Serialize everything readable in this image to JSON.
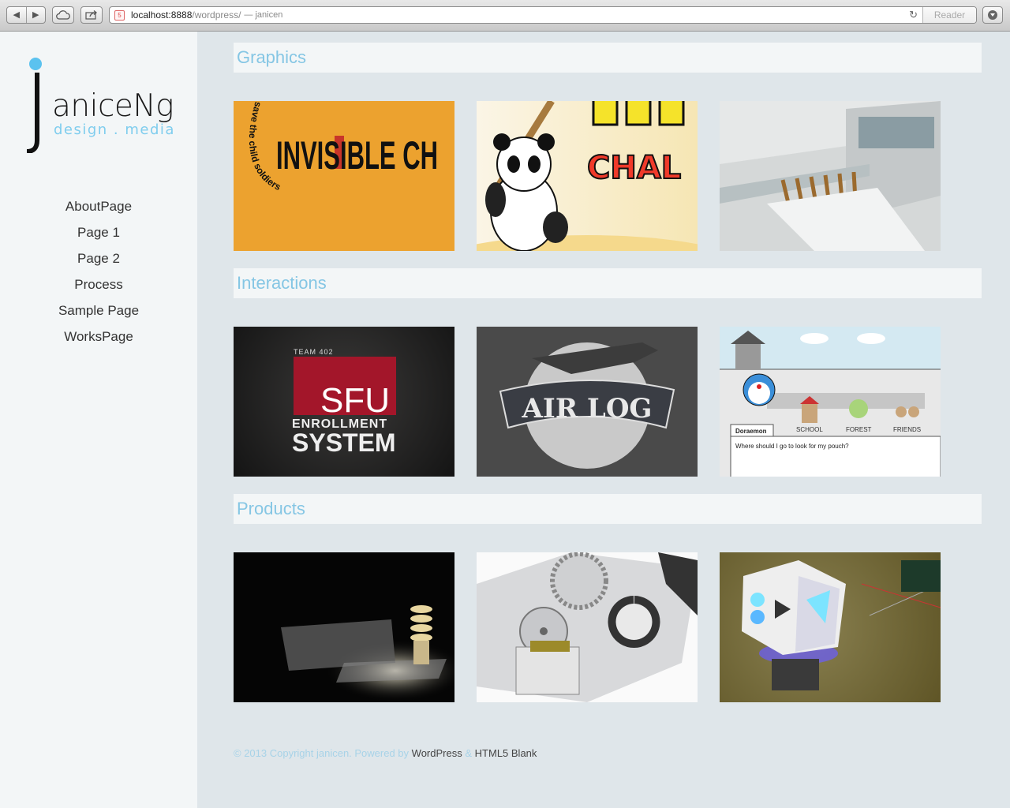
{
  "browser": {
    "url_host": "localhost:8888",
    "url_path": "/wordpress/",
    "page_title": "— janicen",
    "reader_label": "Reader"
  },
  "logo": {
    "name": "aniceNg",
    "tagline": "design . media"
  },
  "nav": [
    {
      "label": "AboutPage"
    },
    {
      "label": "Page 1"
    },
    {
      "label": "Page 2"
    },
    {
      "label": "Process"
    },
    {
      "label": "Sample Page"
    },
    {
      "label": "WorksPage"
    }
  ],
  "sections": [
    {
      "title": "Graphics",
      "items": [
        {
          "text": "INVISIBLE CH",
          "caption": "save the child soldiers"
        },
        {
          "text": "CHAL"
        },
        {
          "text": ""
        }
      ]
    },
    {
      "title": "Interactions",
      "items": [
        {
          "kicker": "TEAM 402",
          "top": "SFU",
          "mid": "ENROLLMENT",
          "bottom": "SYSTEM"
        },
        {
          "text": "AIR LOG"
        },
        {
          "tab": "Doraemon",
          "labels": [
            "SCHOOL",
            "FOREST",
            "FRIENDS"
          ],
          "prompt": "Where should I go to look for my pouch?"
        }
      ]
    },
    {
      "title": "Products",
      "items": [
        {},
        {},
        {}
      ]
    }
  ],
  "footer": {
    "copyright": "© 2013 Copyright janicen. Powered by",
    "link1": "WordPress",
    "amp": "&",
    "link2": "HTML5 Blank"
  },
  "colors": {
    "accent": "#85c6e4",
    "sidebar_bg": "#f3f6f7",
    "page_bg": "#dfe6ea"
  }
}
